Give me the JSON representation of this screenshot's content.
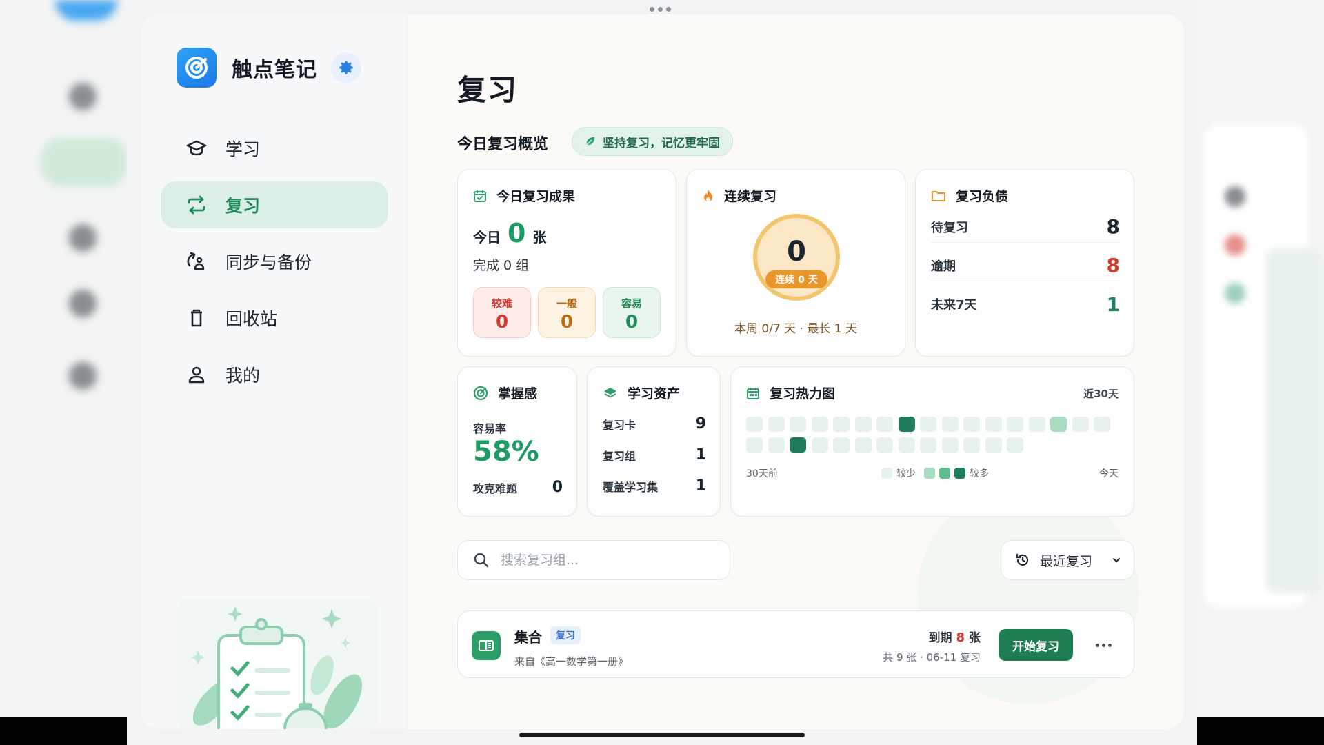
{
  "brand": {
    "name": "触点笔记"
  },
  "nav": {
    "items": [
      {
        "label": "学习",
        "icon": "graduation-cap-icon"
      },
      {
        "label": "复习",
        "icon": "repeat-icon",
        "active": true
      },
      {
        "label": "同步与备份",
        "icon": "sync-icon"
      },
      {
        "label": "回收站",
        "icon": "trash-icon"
      },
      {
        "label": "我的",
        "icon": "user-icon"
      }
    ]
  },
  "page": {
    "title": "复习",
    "overview_title": "今日复习概览",
    "tip": "坚持复习，记忆更牢固"
  },
  "today_result": {
    "title": "今日复习成果",
    "today_label": "今日",
    "today_value": "0",
    "today_unit": "张",
    "done_text": "完成 0 组",
    "ratings": [
      {
        "label": "较难",
        "value": "0"
      },
      {
        "label": "一般",
        "value": "0"
      },
      {
        "label": "容易",
        "value": "0"
      }
    ]
  },
  "streak": {
    "title": "连续复习",
    "value": "0",
    "chip": "连续 0 天",
    "week_text": "本周 0/7 天 · 最长 1 天"
  },
  "debt": {
    "title": "复习负债",
    "rows": [
      {
        "label": "待复习",
        "value": "8"
      },
      {
        "label": "逾期",
        "value": "8"
      },
      {
        "label": "未来7天",
        "value": "1"
      }
    ]
  },
  "mastery": {
    "title": "掌握感",
    "rate_label": "容易率",
    "rate_value": "58%",
    "hard_label": "攻克难题",
    "hard_value": "0"
  },
  "assets": {
    "title": "学习资产",
    "rows": [
      {
        "label": "复习卡",
        "value": "9"
      },
      {
        "label": "复习组",
        "value": "1"
      },
      {
        "label": "覆盖学习集",
        "value": "1"
      }
    ]
  },
  "heatmap": {
    "title": "复习热力图",
    "range": "近30天",
    "start_label": "30天前",
    "end_label": "今天",
    "legend_less": "较少",
    "legend_more": "较多",
    "levels": [
      0,
      0,
      0,
      0,
      0,
      0,
      0,
      3,
      0,
      0,
      0,
      0,
      0,
      0,
      1,
      0,
      0,
      0,
      0,
      3,
      0,
      0,
      0,
      0,
      0,
      0,
      0,
      0,
      0,
      0
    ],
    "colors": {
      "l0": "#e6f1ec",
      "l1": "#a8dcc0",
      "l2": "#5dbb8c",
      "l3": "#1f7d5c"
    }
  },
  "search": {
    "placeholder": "搜索复习组..."
  },
  "sort": {
    "label": "最近复习"
  },
  "list": [
    {
      "name": "集合",
      "tag": "复习",
      "source": "来自《高一数学第一册》",
      "due_prefix": "到期",
      "due_count": "8",
      "due_unit": "张",
      "meta": "共 9 张 · 06-11 复习",
      "action": "开始复习"
    }
  ]
}
